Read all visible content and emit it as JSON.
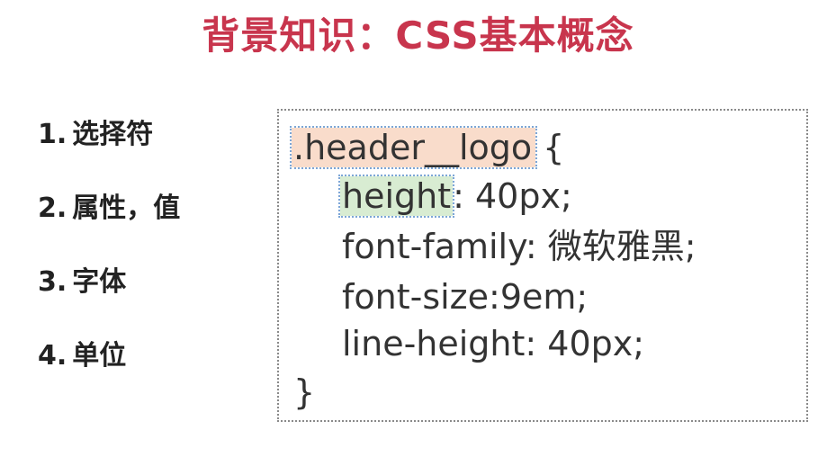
{
  "title": "背景知识：CSS基本概念",
  "topics": [
    {
      "num": "1.",
      "label": "选择符"
    },
    {
      "num": "2.",
      "label": "属性，值"
    },
    {
      "num": "3.",
      "label": "字体"
    },
    {
      "num": "4.",
      "label": "单位"
    }
  ],
  "code": {
    "selector": ".header__logo",
    "open_brace": "{",
    "declarations": [
      {
        "property": "height",
        "rest": ": 40px;"
      },
      {
        "property": "font-family",
        "rest": ": 微软雅黑;"
      },
      {
        "property": "font-size",
        "rest": ":9em;"
      },
      {
        "property": "line-height",
        "rest": ": 40px;"
      }
    ],
    "close_brace": "}"
  },
  "colors": {
    "title": "#c8354d",
    "selector_highlight": "#f9dccb",
    "property_highlight": "#d8ecd2",
    "highlight_outline": "#7ca6d6"
  }
}
